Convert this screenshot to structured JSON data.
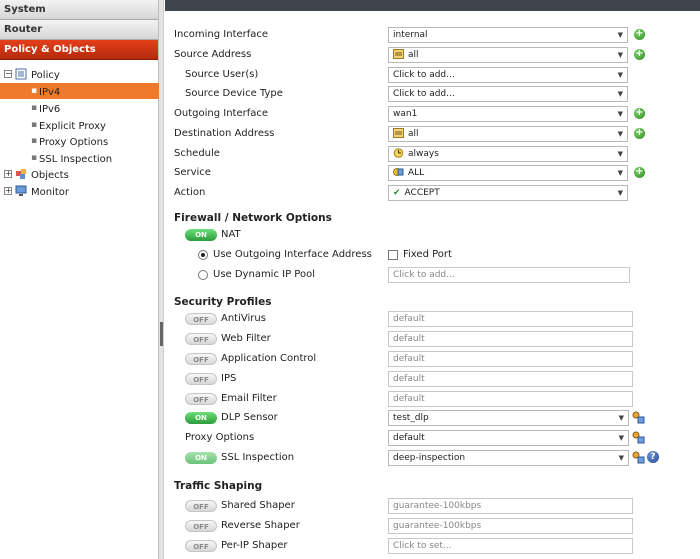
{
  "sidebar": {
    "sections": [
      "System",
      "Router",
      "Policy & Objects"
    ],
    "policy": {
      "label": "Policy",
      "children": [
        "IPv4",
        "IPv6",
        "Explicit Proxy",
        "Proxy Options",
        "SSL Inspection"
      ]
    },
    "objects_label": "Objects",
    "monitor_label": "Monitor"
  },
  "form": {
    "incoming_interface": {
      "label": "Incoming Interface",
      "value": "internal"
    },
    "source_address": {
      "label": "Source Address",
      "value": "all"
    },
    "source_users": {
      "label": "Source User(s)",
      "value": "Click to add..."
    },
    "source_device_type": {
      "label": "Source Device Type",
      "value": "Click to add..."
    },
    "outgoing_interface": {
      "label": "Outgoing Interface",
      "value": "wan1"
    },
    "destination_address": {
      "label": "Destination Address",
      "value": "all"
    },
    "schedule": {
      "label": "Schedule",
      "value": "always"
    },
    "service": {
      "label": "Service",
      "value": "ALL"
    },
    "action": {
      "label": "Action",
      "value": "ACCEPT"
    }
  },
  "firewall": {
    "heading": "Firewall / Network Options",
    "nat": {
      "label": "NAT",
      "toggle": "ON"
    },
    "use_outgoing": "Use Outgoing Interface Address",
    "fixed_port": "Fixed Port",
    "use_dynamic": "Use Dynamic IP Pool",
    "dynamic_placeholder": "Click to add..."
  },
  "security": {
    "heading": "Security Profiles",
    "antivirus": {
      "label": "AntiVirus",
      "toggle": "OFF",
      "value": "default"
    },
    "web_filter": {
      "label": "Web Filter",
      "toggle": "OFF",
      "value": "default"
    },
    "app_control": {
      "label": "Application Control",
      "toggle": "OFF",
      "value": "default"
    },
    "ips": {
      "label": "IPS",
      "toggle": "OFF",
      "value": "default"
    },
    "email_filter": {
      "label": "Email Filter",
      "toggle": "OFF",
      "value": "default"
    },
    "dlp_sensor": {
      "label": "DLP Sensor",
      "toggle": "ON",
      "value": "test_dlp"
    },
    "proxy_options": {
      "label": "Proxy Options",
      "value": "default"
    },
    "ssl_inspection": {
      "label": "SSL Inspection",
      "toggle": "ON",
      "value": "deep-inspection"
    }
  },
  "traffic": {
    "heading": "Traffic Shaping",
    "shared_shaper": {
      "label": "Shared Shaper",
      "toggle": "OFF",
      "value": "guarantee-100kbps"
    },
    "reverse_shaper": {
      "label": "Reverse Shaper",
      "toggle": "OFF",
      "value": "guarantee-100kbps"
    },
    "per_ip_shaper": {
      "label": "Per-IP Shaper",
      "toggle": "OFF",
      "value": "Click to set..."
    }
  },
  "colors": {
    "active_section": "#c9321a",
    "selected_tree": "#ef7a2c",
    "toggle_on": "#2fa23c",
    "topbar": "#3f454c"
  },
  "icons": [
    "plus-icon",
    "address-icon",
    "schedule-icon",
    "service-icon",
    "check-icon",
    "config-icon",
    "help-icon"
  ]
}
